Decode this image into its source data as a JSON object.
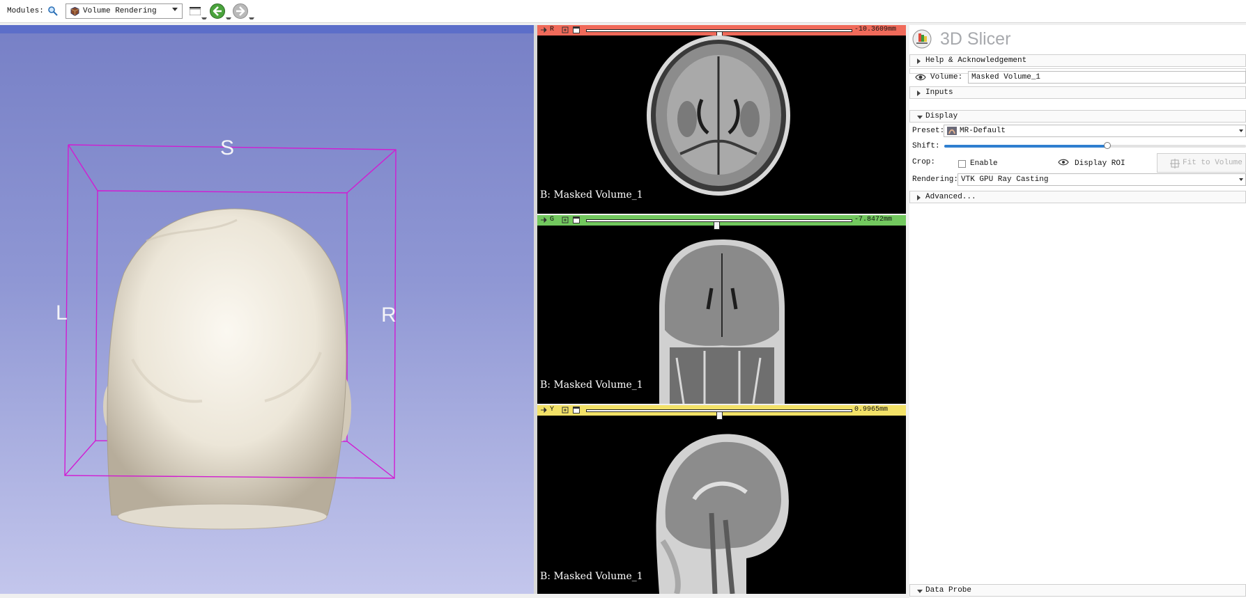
{
  "toolbar": {
    "modules_label": "Modules:",
    "search_icon": "search-icon",
    "module_selected": "Volume Rendering",
    "layout_icon": "layout-icon",
    "back_icon": "back-arrow-icon",
    "forward_icon": "forward-arrow-icon"
  },
  "view3d": {
    "orientation": {
      "superior": "S",
      "left": "L",
      "right": "R"
    },
    "colors": {
      "bg_top": "#7780c6",
      "bg_bottom": "#c3c6ec",
      "roi_box": "#d21bd2"
    }
  },
  "slices": [
    {
      "letter": "R",
      "color": "#f06a5a",
      "offset": "-10.3609mm",
      "slider_fraction": 0.5,
      "label": "B: Masked Volume_1"
    },
    {
      "letter": "G",
      "color": "#72c85e",
      "offset": "-7.8472mm",
      "slider_fraction": 0.49,
      "label": "B: Masked Volume_1"
    },
    {
      "letter": "Y",
      "color": "#f2e167",
      "offset": "0.9965mm",
      "slider_fraction": 0.5,
      "label": "B: Masked Volume_1"
    }
  ],
  "panel": {
    "app_title": "3D Slicer",
    "help_section": "Help & Acknowledgement",
    "volume_label": "Volume:",
    "volume_value": "Masked Volume_1",
    "inputs_section": "Inputs",
    "display_section": "Display",
    "preset_label": "Preset:",
    "preset_value": "MR-Default",
    "shift_label": "Shift:",
    "shift_fraction": 0.54,
    "crop_label": "Crop:",
    "enable_label": "Enable",
    "enable_checked": false,
    "display_roi_label": "Display ROI",
    "fit_volume_label": "Fit to Volume",
    "rendering_label": "Rendering:",
    "rendering_value": "VTK GPU Ray Casting",
    "advanced_section": "Advanced...",
    "data_probe_section": "Data Probe",
    "accent": "#2f7fd0"
  }
}
